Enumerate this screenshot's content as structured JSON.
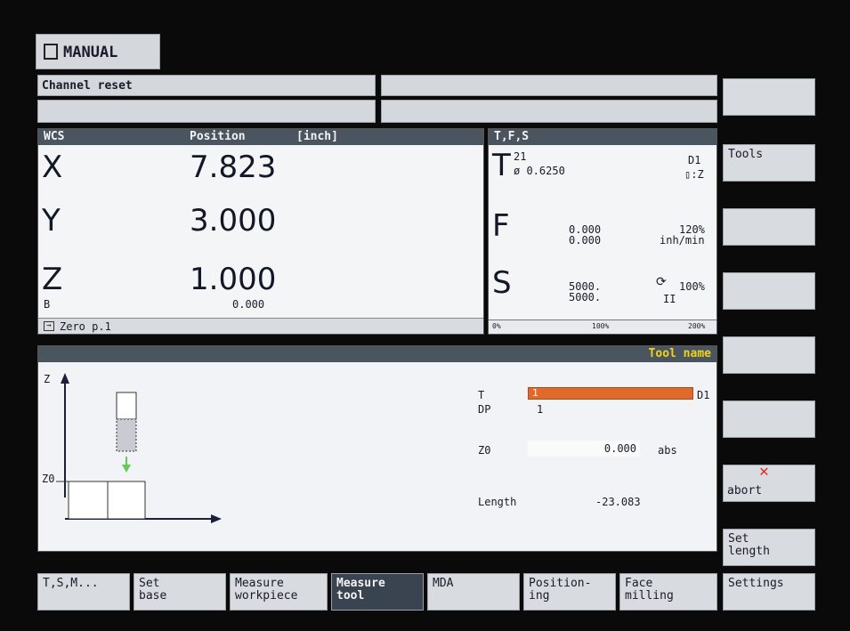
{
  "mode": {
    "label": "MANUAL"
  },
  "status": {
    "message": "Channel reset"
  },
  "pos": {
    "col_wcs": "WCS",
    "col_pos": "Position",
    "unit": "[inch]",
    "axes": [
      {
        "name": "X",
        "value": "7.823"
      },
      {
        "name": "Y",
        "value": "3.000"
      },
      {
        "name": "Z",
        "value": "1.000"
      }
    ],
    "b_label": "B",
    "b_value": "0.000",
    "zero": "Zero p.1"
  },
  "tfs": {
    "title": "T,F,S",
    "t_num": "21",
    "t_dia": "ø 0.6250",
    "t_d": "D1",
    "t_plane": "▯:Z",
    "f_val1": "0.000",
    "f_val2": "0.000",
    "f_pct": "120%",
    "f_unit": "inh/min",
    "s_val1": "5000.",
    "s_val2": "5000.",
    "s_pct": "100%",
    "s_gear": "II",
    "scale_0": "0%",
    "scale_100": "100%",
    "scale_200": "200%"
  },
  "meas": {
    "title": "Tool name",
    "z": "Z",
    "z0": "Z0",
    "t_label": "T",
    "t_num": "1",
    "d": "D1",
    "dp_label": "DP",
    "dp_val": "1",
    "z0_label": "Z0",
    "z0_val": "0.000",
    "abs": "abs",
    "len_label": "Length",
    "len_val": "-23.083"
  },
  "right": [
    {
      "label": ""
    },
    {
      "label": "Tools"
    },
    {
      "label": ""
    },
    {
      "label": ""
    },
    {
      "label": ""
    },
    {
      "label": ""
    },
    {
      "label": "abort"
    },
    {
      "label": "Set\nlength"
    }
  ],
  "bottom": [
    {
      "label": "T,S,M..."
    },
    {
      "label": "Set\nbase"
    },
    {
      "label": "Measure\nworkpiece"
    },
    {
      "label": "Measure\ntool"
    },
    {
      "label": "MDA"
    },
    {
      "label": "Position-\ning"
    },
    {
      "label": "Face\nmilling"
    },
    {
      "label": "Settings"
    }
  ],
  "colors": {
    "accent": "#e06a2c",
    "title_yellow": "#f2d21a",
    "header": "#4a5560",
    "green_arrow": "#66cc55",
    "abort_x": "#e02828"
  }
}
